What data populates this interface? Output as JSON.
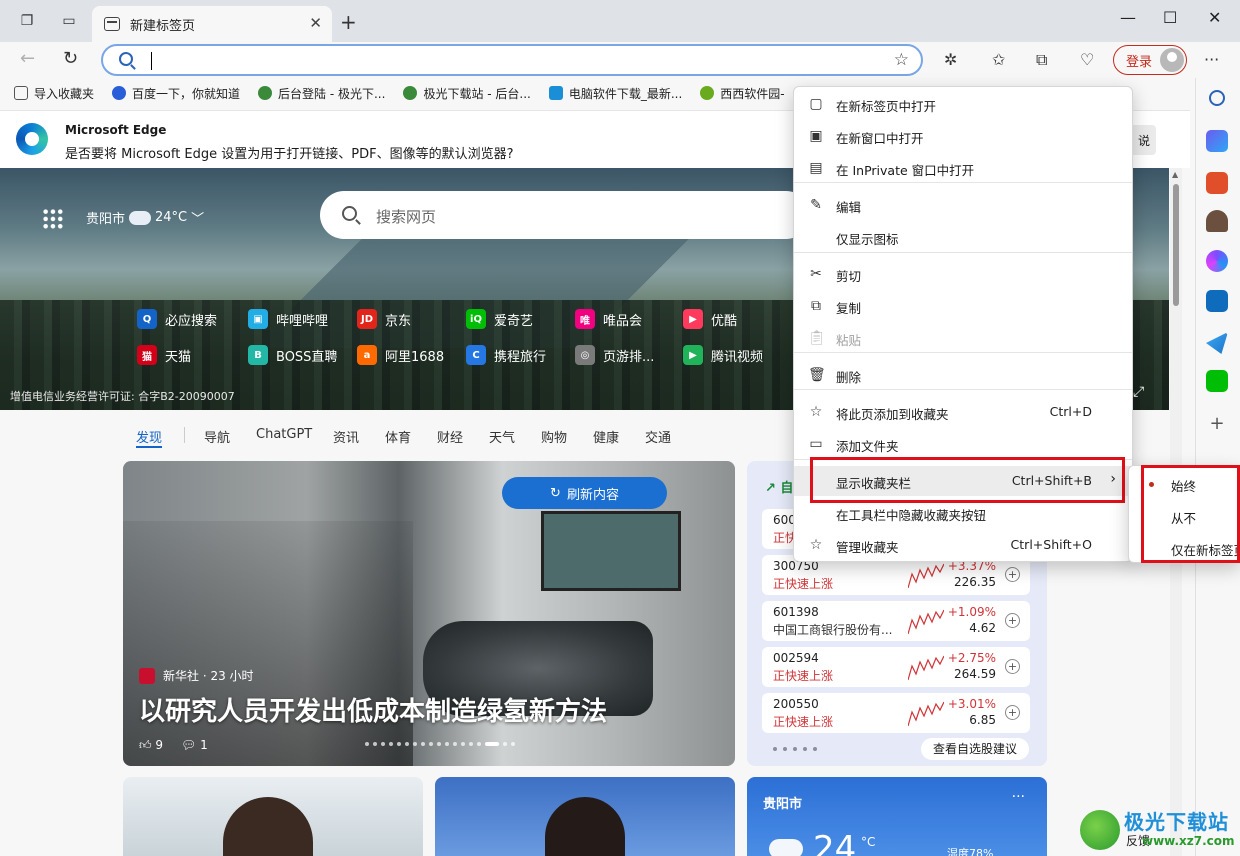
{
  "tab": {
    "title": "新建标签页"
  },
  "bookmarks": [
    {
      "label": "导入收藏夹",
      "color": "#555555"
    },
    {
      "label": "百度一下，你就知道",
      "color": "#2a5dd8"
    },
    {
      "label": "后台登陆 - 极光下...",
      "color": "#3b8a3b"
    },
    {
      "label": "极光下载站 - 后台...",
      "color": "#3b8a3b"
    },
    {
      "label": "电脑软件下载_最新...",
      "color": "#1a8fd8"
    },
    {
      "label": "西西软件园-",
      "color": "#6aaa1e"
    }
  ],
  "login_label": "登录",
  "infobar": {
    "title": "Microsoft Edge",
    "message": "是否要将 Microsoft Edge 设置为用于打开链接、PDF、图像等的默认浏览器?",
    "button_label": "说"
  },
  "hero": {
    "city": "贵阳市",
    "temp": "24°C",
    "search_placeholder": "搜索网页",
    "license": "增值电信业务经营许可证: 合字B2-20090007",
    "links": [
      {
        "label": "必应搜索",
        "icon": "bing-icon",
        "color": "#1363c8",
        "glyph": "Q"
      },
      {
        "label": "哔哩哔哩",
        "icon": "bilibili-icon",
        "color": "#23ade5",
        "glyph": "▣"
      },
      {
        "label": "京东",
        "icon": "jd-icon",
        "color": "#e1251b",
        "glyph": "JD"
      },
      {
        "label": "爱奇艺",
        "icon": "iqiyi-icon",
        "color": "#00be06",
        "glyph": "iQ"
      },
      {
        "label": "唯品会",
        "icon": "vip-icon",
        "color": "#f10180",
        "glyph": "唯"
      },
      {
        "label": "优酷",
        "icon": "youku-icon",
        "color": "#ff3a5c",
        "glyph": "▶"
      },
      {
        "label": "天猫",
        "icon": "tmall-icon",
        "color": "#d4001a",
        "glyph": "猫"
      },
      {
        "label": "BOSS直聘",
        "icon": "boss-icon",
        "color": "#23b7a6",
        "glyph": "B"
      },
      {
        "label": "阿里1688",
        "icon": "alibaba-icon",
        "color": "#ff6a00",
        "glyph": "a"
      },
      {
        "label": "携程旅行",
        "icon": "ctrip-icon",
        "color": "#2577e3",
        "glyph": "C"
      },
      {
        "label": "页游排...",
        "icon": "games-icon",
        "color": "#7a7a7a",
        "glyph": "◎"
      },
      {
        "label": "腾讯视频",
        "icon": "tencent-video-icon",
        "color": "#20b35a",
        "glyph": "▶"
      }
    ]
  },
  "content_nav": [
    "发现",
    "导航",
    "ChatGPT",
    "资讯",
    "体育",
    "财经",
    "天气",
    "购物",
    "健康",
    "交通"
  ],
  "news": {
    "refresh_label": "刷新内容",
    "source": "新华社 · 23 小时",
    "headline": "以研究人员开发出低成本制造绿氢新方法",
    "likes": "9",
    "dislikes": "1"
  },
  "stocks": {
    "header": "自",
    "rows": [
      {
        "code": "600",
        "sub": "正快",
        "pct": "",
        "price": ""
      },
      {
        "code": "300750",
        "sub": "正快速上涨",
        "pct": "+3.37%",
        "price": "226.35"
      },
      {
        "code": "601398",
        "sub": "中国工商银行股份有...",
        "pct": "+1.09%",
        "price": "4.62"
      },
      {
        "code": "002594",
        "sub": "正快速上涨",
        "pct": "+2.75%",
        "price": "264.59"
      },
      {
        "code": "200550",
        "sub": "正快速上涨",
        "pct": "+3.01%",
        "price": "6.85"
      }
    ],
    "more_label": "查看自选股建议"
  },
  "weather_card": {
    "city": "贵阳市",
    "temp": "24",
    "unit": "°C",
    "humidity": "湿度78%"
  },
  "context_menu": {
    "items": [
      {
        "label": "在新标签页中打开",
        "shortcut": "",
        "icon": "tab-icon"
      },
      {
        "label": "在新窗口中打开",
        "shortcut": "",
        "icon": "window-icon"
      },
      {
        "label": "在 InPrivate 窗口中打开",
        "shortcut": "",
        "icon": "inprivate-icon"
      },
      {
        "label": "编辑",
        "shortcut": "",
        "icon": "pencil-icon"
      },
      {
        "label": "仅显示图标",
        "shortcut": "",
        "icon": ""
      },
      {
        "label": "剪切",
        "shortcut": "",
        "icon": "scissors-icon"
      },
      {
        "label": "复制",
        "shortcut": "",
        "icon": "copy-icon"
      },
      {
        "label": "粘贴",
        "shortcut": "",
        "icon": "paste-icon"
      },
      {
        "label": "删除",
        "shortcut": "",
        "icon": "trash-icon"
      },
      {
        "label": "将此页添加到收藏夹",
        "shortcut": "Ctrl+D",
        "icon": "star-add-icon"
      },
      {
        "label": "添加文件夹",
        "shortcut": "",
        "icon": "folder-add-icon"
      },
      {
        "label": "显示收藏夹栏",
        "shortcut": "Ctrl+Shift+B",
        "icon": ""
      },
      {
        "label": "在工具栏中隐藏收藏夹按钮",
        "shortcut": "",
        "icon": ""
      },
      {
        "label": "管理收藏夹",
        "shortcut": "Ctrl+Shift+O",
        "icon": "star-settings-icon"
      }
    ]
  },
  "submenu": {
    "items": [
      "始终",
      "从不",
      "仅在新标签页"
    ]
  },
  "watermark": {
    "text": "极光下载站",
    "url": "www.xz7.com"
  },
  "feedback_label": "反馈"
}
